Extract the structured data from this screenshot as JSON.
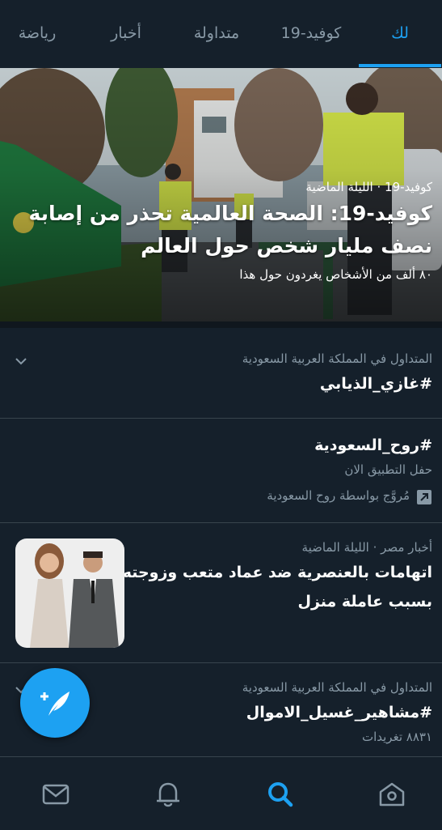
{
  "tabs": [
    {
      "label": "لك",
      "active": true
    },
    {
      "label": "كوفيد-19",
      "active": false
    },
    {
      "label": "متداولة",
      "active": false
    },
    {
      "label": "أخبار",
      "active": false
    },
    {
      "label": "رياضة",
      "active": false
    }
  ],
  "hero": {
    "meta": "كوفيد-19 · الليلة الماضية",
    "title": "كوفيد-19: الصحة العالمية تحذر من إصابة نصف مليار شخص حول العالم",
    "subtitle": "٨٠ ألف من الأشخاص يغردون حول هذا"
  },
  "trend1": {
    "context": "المتداول في المملكة العربية السعودية",
    "title": "#غازي_الذيابي"
  },
  "promoted": {
    "title": "#روح_السعودية",
    "description": "حفل التطبيق الان",
    "promoted_by": "مُروَّج بواسطة روح السعودية"
  },
  "news": {
    "context": "أخبار مصر · الليلة الماضية",
    "headline_line1": "اتهامات بالعنصرية ضد عماد متعب وزوجته",
    "headline_line2": "بسبب عاملة منزل"
  },
  "trend2": {
    "context": "المتداول في المملكة العربية السعودية",
    "title": "#مشاهير_غسيل_الاموال",
    "count": "٨٨٣١ تغريدات"
  },
  "colors": {
    "background": "#15202b",
    "accent": "#1da1f2",
    "secondary_text": "#8899a6",
    "divider": "#38444d"
  },
  "icons": {
    "fab": "compose-tweet-icon",
    "nav": [
      "messages-icon",
      "notifications-icon",
      "search-icon",
      "home-icon"
    ]
  }
}
